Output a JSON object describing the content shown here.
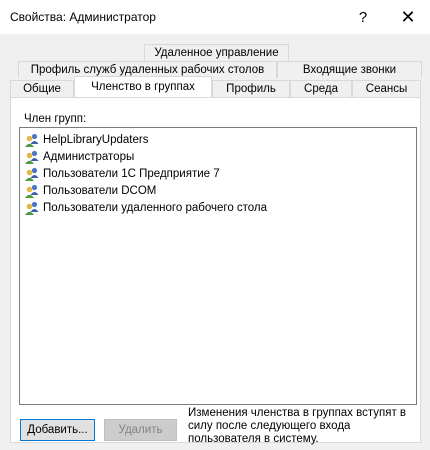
{
  "window": {
    "title": "Свойства: Администратор",
    "help_glyph": "?",
    "close_glyph": "✕"
  },
  "tabs": {
    "row1": [
      "Удаленное управление"
    ],
    "row2": [
      "Профиль служб удаленных рабочих столов",
      "Входящие звонки"
    ],
    "row3": [
      "Общие",
      "Членство в группах",
      "Профиль",
      "Среда",
      "Сеансы"
    ],
    "active": "Членство в группах"
  },
  "membership": {
    "label": "Член групп:",
    "groups": [
      "HelpLibraryUpdaters",
      "Администраторы",
      "Пользователи 1С Предприятие 7",
      "Пользователи DCOM",
      "Пользователи удаленного рабочего стола"
    ],
    "group_icon": "user-group-icon"
  },
  "buttons": {
    "add_label": "Добавить...",
    "remove_label": "Удалить"
  },
  "note": "Изменения членства в группах вступят в силу после следующего входа пользователя в систему."
}
